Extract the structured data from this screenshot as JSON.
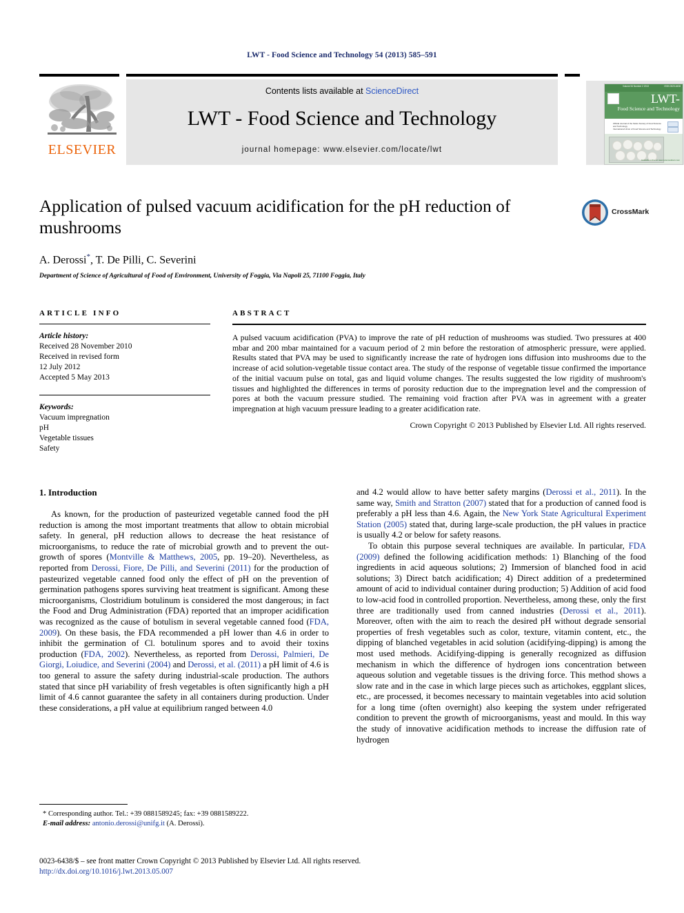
{
  "running_head": "LWT - Food Science and Technology 54 (2013) 585–591",
  "masthead": {
    "contents_prefix": "Contents lists available at ",
    "contents_link": "ScienceDirect",
    "journal_title": "LWT - Food Science and Technology",
    "homepage": "journal homepage: www.elsevier.com/locate/lwt",
    "publisher_logo_text": "ELSEVIER",
    "cover": {
      "top_bar_left": "Volume 54  Number 2   2013",
      "top_bar_right": "ISSN 0023-6438",
      "title": "LWT-",
      "subtitle": "Food Science and Technology",
      "line1": "Official Journal of the Swiss Society of Food Science and Technology",
      "line2": "International Union of Food Science and Technology",
      "footnote": "Available online at www.sciencedirect.com"
    }
  },
  "article": {
    "title": "Application of pulsed vacuum acidification for the pH reduction of mushrooms",
    "authors": "A. Derossi",
    "authors_rest": ", T. De Pilli, C. Severini",
    "corresponding_marker": "*",
    "affiliation": "Department of Science of Agricultural of Food of Environment, University of Foggia, Via Napoli 25, 71100 Foggia, Italy",
    "crossmark_label": "CrossMark"
  },
  "info": {
    "heading": "ARTICLE INFO",
    "history_label": "Article history:",
    "history": [
      "Received 28 November 2010",
      "Received in revised form",
      "12 July 2012",
      "Accepted 5 May 2013"
    ],
    "keywords_label": "Keywords:",
    "keywords": [
      "Vacuum impregnation",
      "pH",
      "Vegetable tissues",
      "Safety"
    ]
  },
  "abstract": {
    "heading": "ABSTRACT",
    "text": "A pulsed vacuum acidification (PVA) to improve the rate of pH reduction of mushrooms was studied. Two pressures at 400 mbar and 200 mbar maintained for a vacuum period of 2 min before the restoration of atmospheric pressure, were applied. Results stated that PVA may be used to significantly increase the rate of hydrogen ions diffusion into mushrooms due to the increase of acid solution-vegetable tissue contact area. The study of the response of vegetable tissue confirmed the importance of the initial vacuum pulse on total, gas and liquid volume changes. The results suggested the low rigidity of mushroom's tissues and highlighted the differences in terms of porosity reduction due to the impregnation level and the compression of pores at both the vacuum pressure studied. The remaining void fraction after PVA was in agreement with a greater impregnation at high vacuum pressure leading to a greater acidification rate.",
    "copyright": "Crown Copyright © 2013 Published by Elsevier Ltd. All rights reserved."
  },
  "body": {
    "section_heading": "1. Introduction",
    "left_paragraph_1_a": "As known, for the production of pasteurized vegetable canned food the pH reduction is among the most important treatments that allow to obtain microbial safety. In general, pH reduction allows to decrease the heat resistance of microorganisms, to reduce the rate of microbial growth and to prevent the out-growth of spores (",
    "ref_montville": "Montville & Matthews, 2005",
    "left_paragraph_1_b": ", pp. 19–20). Nevertheless, as reported from ",
    "ref_derossi_fiore": "Derossi, Fiore, De Pilli, and Severini (2011)",
    "left_paragraph_1_c": " for the production of pasteurized vegetable canned food only the effect of pH on the prevention of germination pathogens spores surviving heat treatment is significant. Among these microorganisms, Clostridium botulinum is considered the most dangerous; in fact the Food and Drug Administration (FDA) reported that an improper acidification was recognized as the cause of botulism in several vegetable canned food (",
    "ref_fda_2009": "FDA, 2009",
    "left_paragraph_1_d": "). On these basis, the FDA recommended a pH lower than 4.6 in order to inhibit the germination of Cl. botulinum spores and to avoid their toxins production (",
    "ref_fda_2002": "FDA, 2002",
    "left_paragraph_1_e": "). Nevertheless, as reported from ",
    "ref_derossi_palmieri": "Derossi, Palmieri, De Giorgi, Loiudice, and Severini (2004)",
    "left_paragraph_1_f": " and ",
    "ref_derossi_etal": "Derossi, et al. (2011)",
    "left_paragraph_1_g": " a pH limit of 4.6 is too general to assure the safety during industrial-scale production. The authors stated that since pH variability of fresh vegetables is often significantly high a pH limit of 4.6 cannot guarantee the safety in all containers during production. Under these considerations, a pH value at equilibrium ranged between 4.0",
    "right_paragraph_1_a": "and 4.2 would allow to have better safety margins (",
    "ref_derossi_2011_r": "Derossi et al., 2011",
    "right_paragraph_1_b": "). In the same way, ",
    "ref_smith_stratton": "Smith and Stratton (2007)",
    "right_paragraph_1_c": " stated that for a production of canned food is preferably a pH less than 4.6. Again, the ",
    "ref_nysaes": "New York State Agricultural Experiment Station (2005)",
    "right_paragraph_1_d": " stated that, during large-scale production, the pH values in practice is usually 4.2 or below for safety reasons.",
    "right_paragraph_2_a": "To obtain this purpose several techniques are available. In particular, ",
    "ref_fda_2009_r": "FDA (2009)",
    "right_paragraph_2_b": " defined the following acidification methods: 1) Blanching of the food ingredients in acid aqueous solutions; 2) Immersion of blanched food in acid solutions; 3) Direct batch acidification; 4) Direct addition of a predetermined amount of acid to individual container during production; 5) Addition of acid food to low-acid food in controlled proportion. Nevertheless, among these, only the first three are traditionally used from canned industries (",
    "ref_derossi_2011_r2": "Derossi et al., 2011",
    "right_paragraph_2_c": "). Moreover, often with the aim to reach the desired pH without degrade sensorial properties of fresh vegetables such as color, texture, vitamin content, etc., the dipping of blanched vegetables in acid solution (acidifying-dipping) is among the most used methods. Acidifying-dipping is generally recognized as diffusion mechanism in which the difference of hydrogen ions concentration between aqueous solution and vegetable tissues is the driving force. This method shows a slow rate and in the case in which large pieces such as artichokes, eggplant slices, etc., are processed, it becomes necessary to maintain vegetables into acid solution for a long time (often overnight) also keeping the system under refrigerated condition to prevent the growth of microorganisms, yeast and mould. In this way the study of innovative acidification methods to increase the diffusion rate of hydrogen"
  },
  "footnotes": {
    "corresponding": "* Corresponding author. Tel.: +39 0881589245; fax: +39 0881589222.",
    "email_label": "E-mail address:",
    "email": "antonio.derossi@unifg.it",
    "email_attrib": "(A. Derossi)."
  },
  "colophon": {
    "line1": "0023-6438/$ – see front matter Crown Copyright © 2013 Published by Elsevier Ltd. All rights reserved.",
    "doi": "http://dx.doi.org/10.1016/j.lwt.2013.05.007"
  },
  "colors": {
    "link": "#1a3a9e",
    "sciencedirect": "#2b56c4",
    "elsevier_orange": "#eb6209",
    "running_head": "#1a2a6b",
    "band_bg": "#e6e6e6"
  }
}
